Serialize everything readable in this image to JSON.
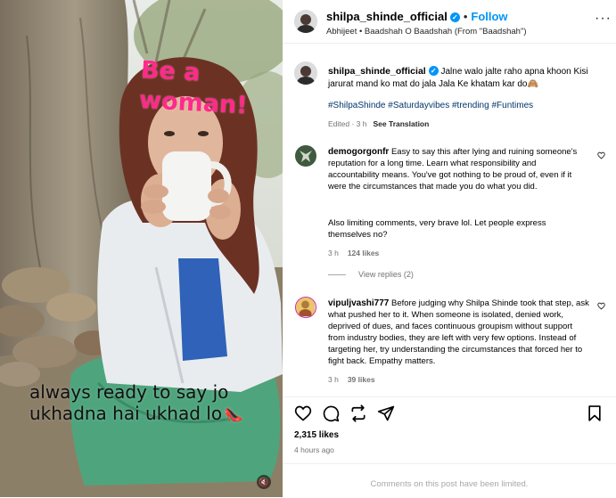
{
  "post": {
    "username": "shilpa_shinde_official",
    "follow_label": "Follow",
    "separator": "•",
    "audio": "Abhijeet • Baadshah O Baadshah (From \"Baadshah\")",
    "more_label": "···"
  },
  "media": {
    "overlay_title": "Be a woman!",
    "overlay_caption": "always ready to say jo ukhadna hai ukhad lo",
    "sound_icon": "muted-speaker-icon"
  },
  "caption": {
    "username": "shilpa_shinde_official",
    "text": "Jalne walo jalte raho apna khoon Kisi jarurat mand ko mat do jala Jala Ke khatam kar do🙈",
    "hashtags": "#ShilpaShinde #Saturdayvibes #trending #Funtimes",
    "edited": "Edited · 3 h",
    "see_translation": "See Translation"
  },
  "comments": [
    {
      "username": "demogorgonfr",
      "text": "Easy to say this after lying and ruining someone's reputation for a long time. Learn what responsibility and accountability means. You've got nothing to be proud of, even if it were the circumstances that made you do what you did.",
      "text2": "Also limiting comments, very brave lol. Let people express themselves no?",
      "time": "3 h",
      "likes": "124 likes",
      "view_replies": "View replies (2)"
    },
    {
      "username": "vipuljvashi777",
      "text": "Before judging why Shilpa Shinde took that step, ask what pushed her to it. When someone is isolated, denied work, deprived of dues, and faces continuous groupism without support from industry bodies, they are left with very few options. Instead of targeting her, try understanding the circumstances that forced her to fight back. Empathy matters.",
      "time": "3 h",
      "likes": "39 likes"
    }
  ],
  "footer": {
    "likes": "2,315 likes",
    "time_ago": "4 hours ago",
    "limited": "Comments on this post have been limited."
  },
  "icons": [
    "verified-badge-icon",
    "more-icon",
    "heart-icon",
    "comment-icon",
    "share-icon",
    "send-icon",
    "bookmark-icon",
    "small-heart-icon"
  ],
  "colors": {
    "accent": "#0095f6",
    "hashtag": "#00376b",
    "muted": "#737373",
    "overlay_title": "#ff2a8c"
  }
}
